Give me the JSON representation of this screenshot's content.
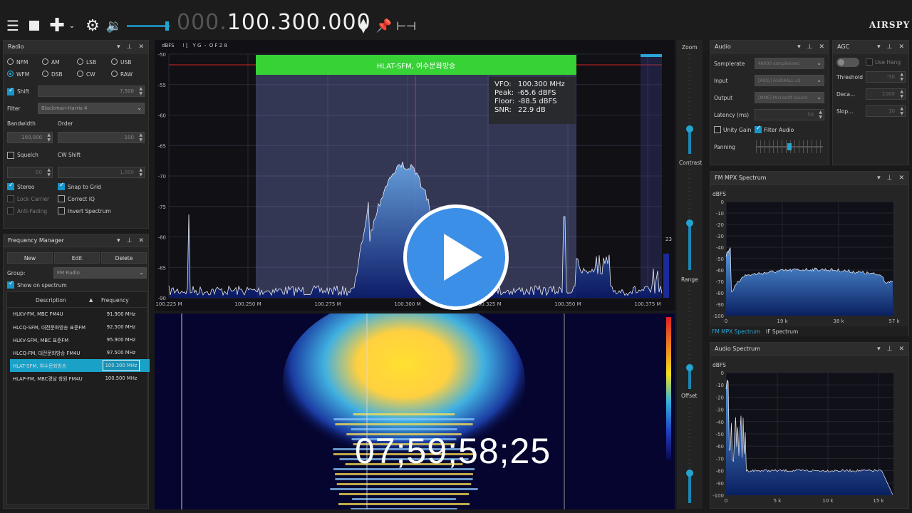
{
  "toolbar": {
    "freq_dim": "000.",
    "freq_lit": "100.300.000",
    "brand": "AIRSPY"
  },
  "spectrum": {
    "y_unit": "dBFS",
    "top_status": "! [   Y G  -  O F 2 8",
    "y_ticks": [
      "-50",
      "-55",
      "-60",
      "-65",
      "-70",
      "-75",
      "-80",
      "-85",
      "-90"
    ],
    "x_ticks": [
      "100.225 M",
      "100.250 M",
      "100.275 M",
      "100.300 M",
      "100.325 M",
      "100.350 M",
      "100.375 M"
    ],
    "station_label": "HLAT-SFM, 여수문화방송",
    "info": {
      "vfo_label": "VFO:",
      "vfo": "100.300 MHz",
      "peak_label": "Peak:",
      "peak": "-65.6 dBFS",
      "floor_label": "Floor:",
      "floor": "-88.5 dBFS",
      "snr_label": "SNR:",
      "snr": "22.9 dB"
    },
    "right_number": "23"
  },
  "waterfall": {
    "timecode": "07;59;58;25"
  },
  "side": {
    "zoom": "Zoom",
    "contrast": "Contrast",
    "range": "Range",
    "offset": "Offset"
  },
  "radio": {
    "title": "Radio",
    "modes": [
      "NFM",
      "AM",
      "LSB",
      "USB",
      "WFM",
      "DSB",
      "CW",
      "RAW"
    ],
    "selected_mode": "WFM",
    "shift_label": "Shift",
    "shift_value": "7,500",
    "filter_label": "Filter",
    "filter_value": "Blackman-Harris 4",
    "bandwidth_label": "Bandwidth",
    "bandwidth_value": "100,000",
    "order_label": "Order",
    "order_value": "100",
    "squelch_label": "Squelch",
    "cwshift_label": "CW Shift",
    "squelch_value": "-50",
    "cwshift_value": "1,000",
    "stereo": "Stereo",
    "snap": "Snap to Grid",
    "lock": "Lock Carrier",
    "correct_iq": "Correct IQ",
    "anti_fading": "Anti-Fading",
    "invert": "Invert Spectrum"
  },
  "freqmgr": {
    "title": "Frequency Manager",
    "new": "New",
    "edit": "Edit",
    "delete": "Delete",
    "group_label": "Group:",
    "group_value": "FM Radio",
    "show_label": "Show on spectrum",
    "col_desc": "Description",
    "col_freq": "Frequency",
    "rows": [
      {
        "desc": "HLKV-FM, MBC FM4U",
        "freq": "91.900 MHz"
      },
      {
        "desc": "HLCQ-SFM, 대전문화방송 표준FM",
        "freq": "92.500 MHz"
      },
      {
        "desc": "HLKV-SFM,  MBC 표준FM",
        "freq": "95.900 MHz"
      },
      {
        "desc": "HLCQ-FM, 대전문화방송 FM4U",
        "freq": "97.500 MHz"
      },
      {
        "desc": "HLAT-SFM, 여수문화방송",
        "freq": "100.300 MHz"
      },
      {
        "desc": "HLAP-FM,  MBC경남 창원 FM4U",
        "freq": "100.500 MHz"
      }
    ],
    "selected_index": 4
  },
  "audio": {
    "title": "Audio",
    "samplerate_label": "Samplerate",
    "samplerate_value": "48000 samples/sec",
    "input_label": "Input",
    "input_value": "[ASIO] ASIO4ALL v2",
    "output_label": "Output",
    "output_value": "[MME] Microsoft Sound",
    "latency_label": "Latency (ms)",
    "latency_value": "50",
    "unity_label": "Unity Gain",
    "filter_label": "Filter Audio",
    "panning_label": "Panning"
  },
  "agc": {
    "title": "AGC",
    "use_hang": "Use Hang",
    "threshold_label": "Threshold",
    "threshold_value": "-50",
    "decay_label": "Deca...",
    "decay_value": "1000",
    "slope_label": "Slop...",
    "slope_value": "10"
  },
  "mpx": {
    "title": "FM MPX Spectrum",
    "unit": "dBFS",
    "y_ticks": [
      "0",
      "-10",
      "-20",
      "-30",
      "-40",
      "-50",
      "-60",
      "-70",
      "-80",
      "-90",
      "-100"
    ],
    "x_ticks": [
      "0",
      "19 k",
      "38 k",
      "57 k"
    ],
    "tab1": "FM MPX Spectrum",
    "tab2": "IF Spectrum"
  },
  "aspec": {
    "title": "Audio Spectrum",
    "unit": "dBFS",
    "y_ticks": [
      "0",
      "-10",
      "-20",
      "-30",
      "-40",
      "-50",
      "-60",
      "-70",
      "-80",
      "-90",
      "-100"
    ],
    "x_ticks": [
      "0",
      "5 k",
      "10 k",
      "15 k"
    ]
  }
}
